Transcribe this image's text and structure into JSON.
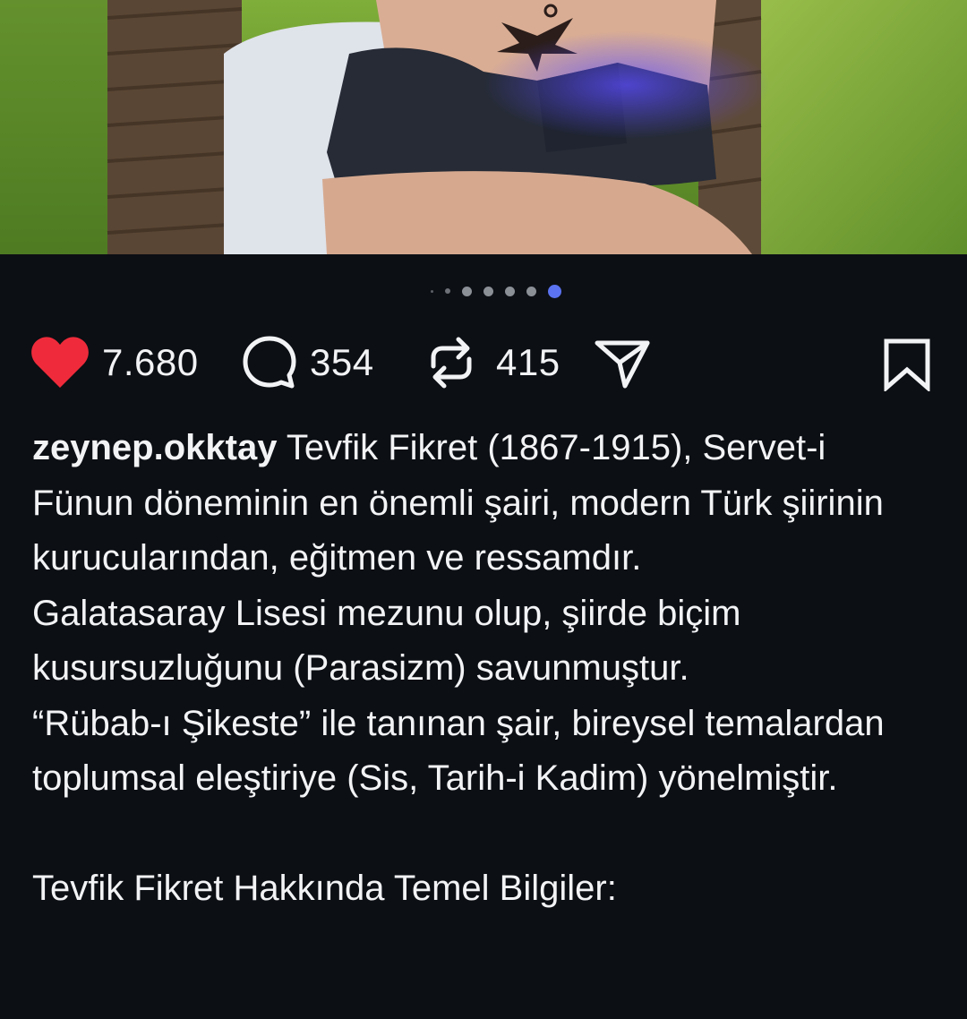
{
  "post": {
    "image_alt": "Photo of person seated on wicker chair on grass",
    "carousel": {
      "total_dots": 7,
      "active_index": 6
    }
  },
  "actions": {
    "likes": "7.680",
    "comments": "354",
    "reposts": "415"
  },
  "caption": {
    "username": "zeynep.okktay",
    "text": " Tevfik Fikret (1867-1915), Servet-i Fünun döneminin en önemli şairi, modern Türk şiirinin kurucularından, eğitmen ve ressamdır.\nGalatasaray Lisesi mezunu olup, şiirde biçim kusursuzluğunu (Parasizm) savunmuştur.\n“Rübab-ı Şikeste” ile tanınan şair, bireysel temalardan toplumsal eleştiriye (Sis, Tarih-i Kadim) yönelmiştir.\n\nTevfik Fikret Hakkında Temel Bilgiler:"
  },
  "colors": {
    "background": "#0c0f14",
    "like_red": "#ef2b3b",
    "active_dot": "#5b73f0",
    "text": "#f2f3f5"
  },
  "icons": [
    "heart-icon",
    "comment-icon",
    "repost-icon",
    "share-icon",
    "bookmark-icon"
  ]
}
